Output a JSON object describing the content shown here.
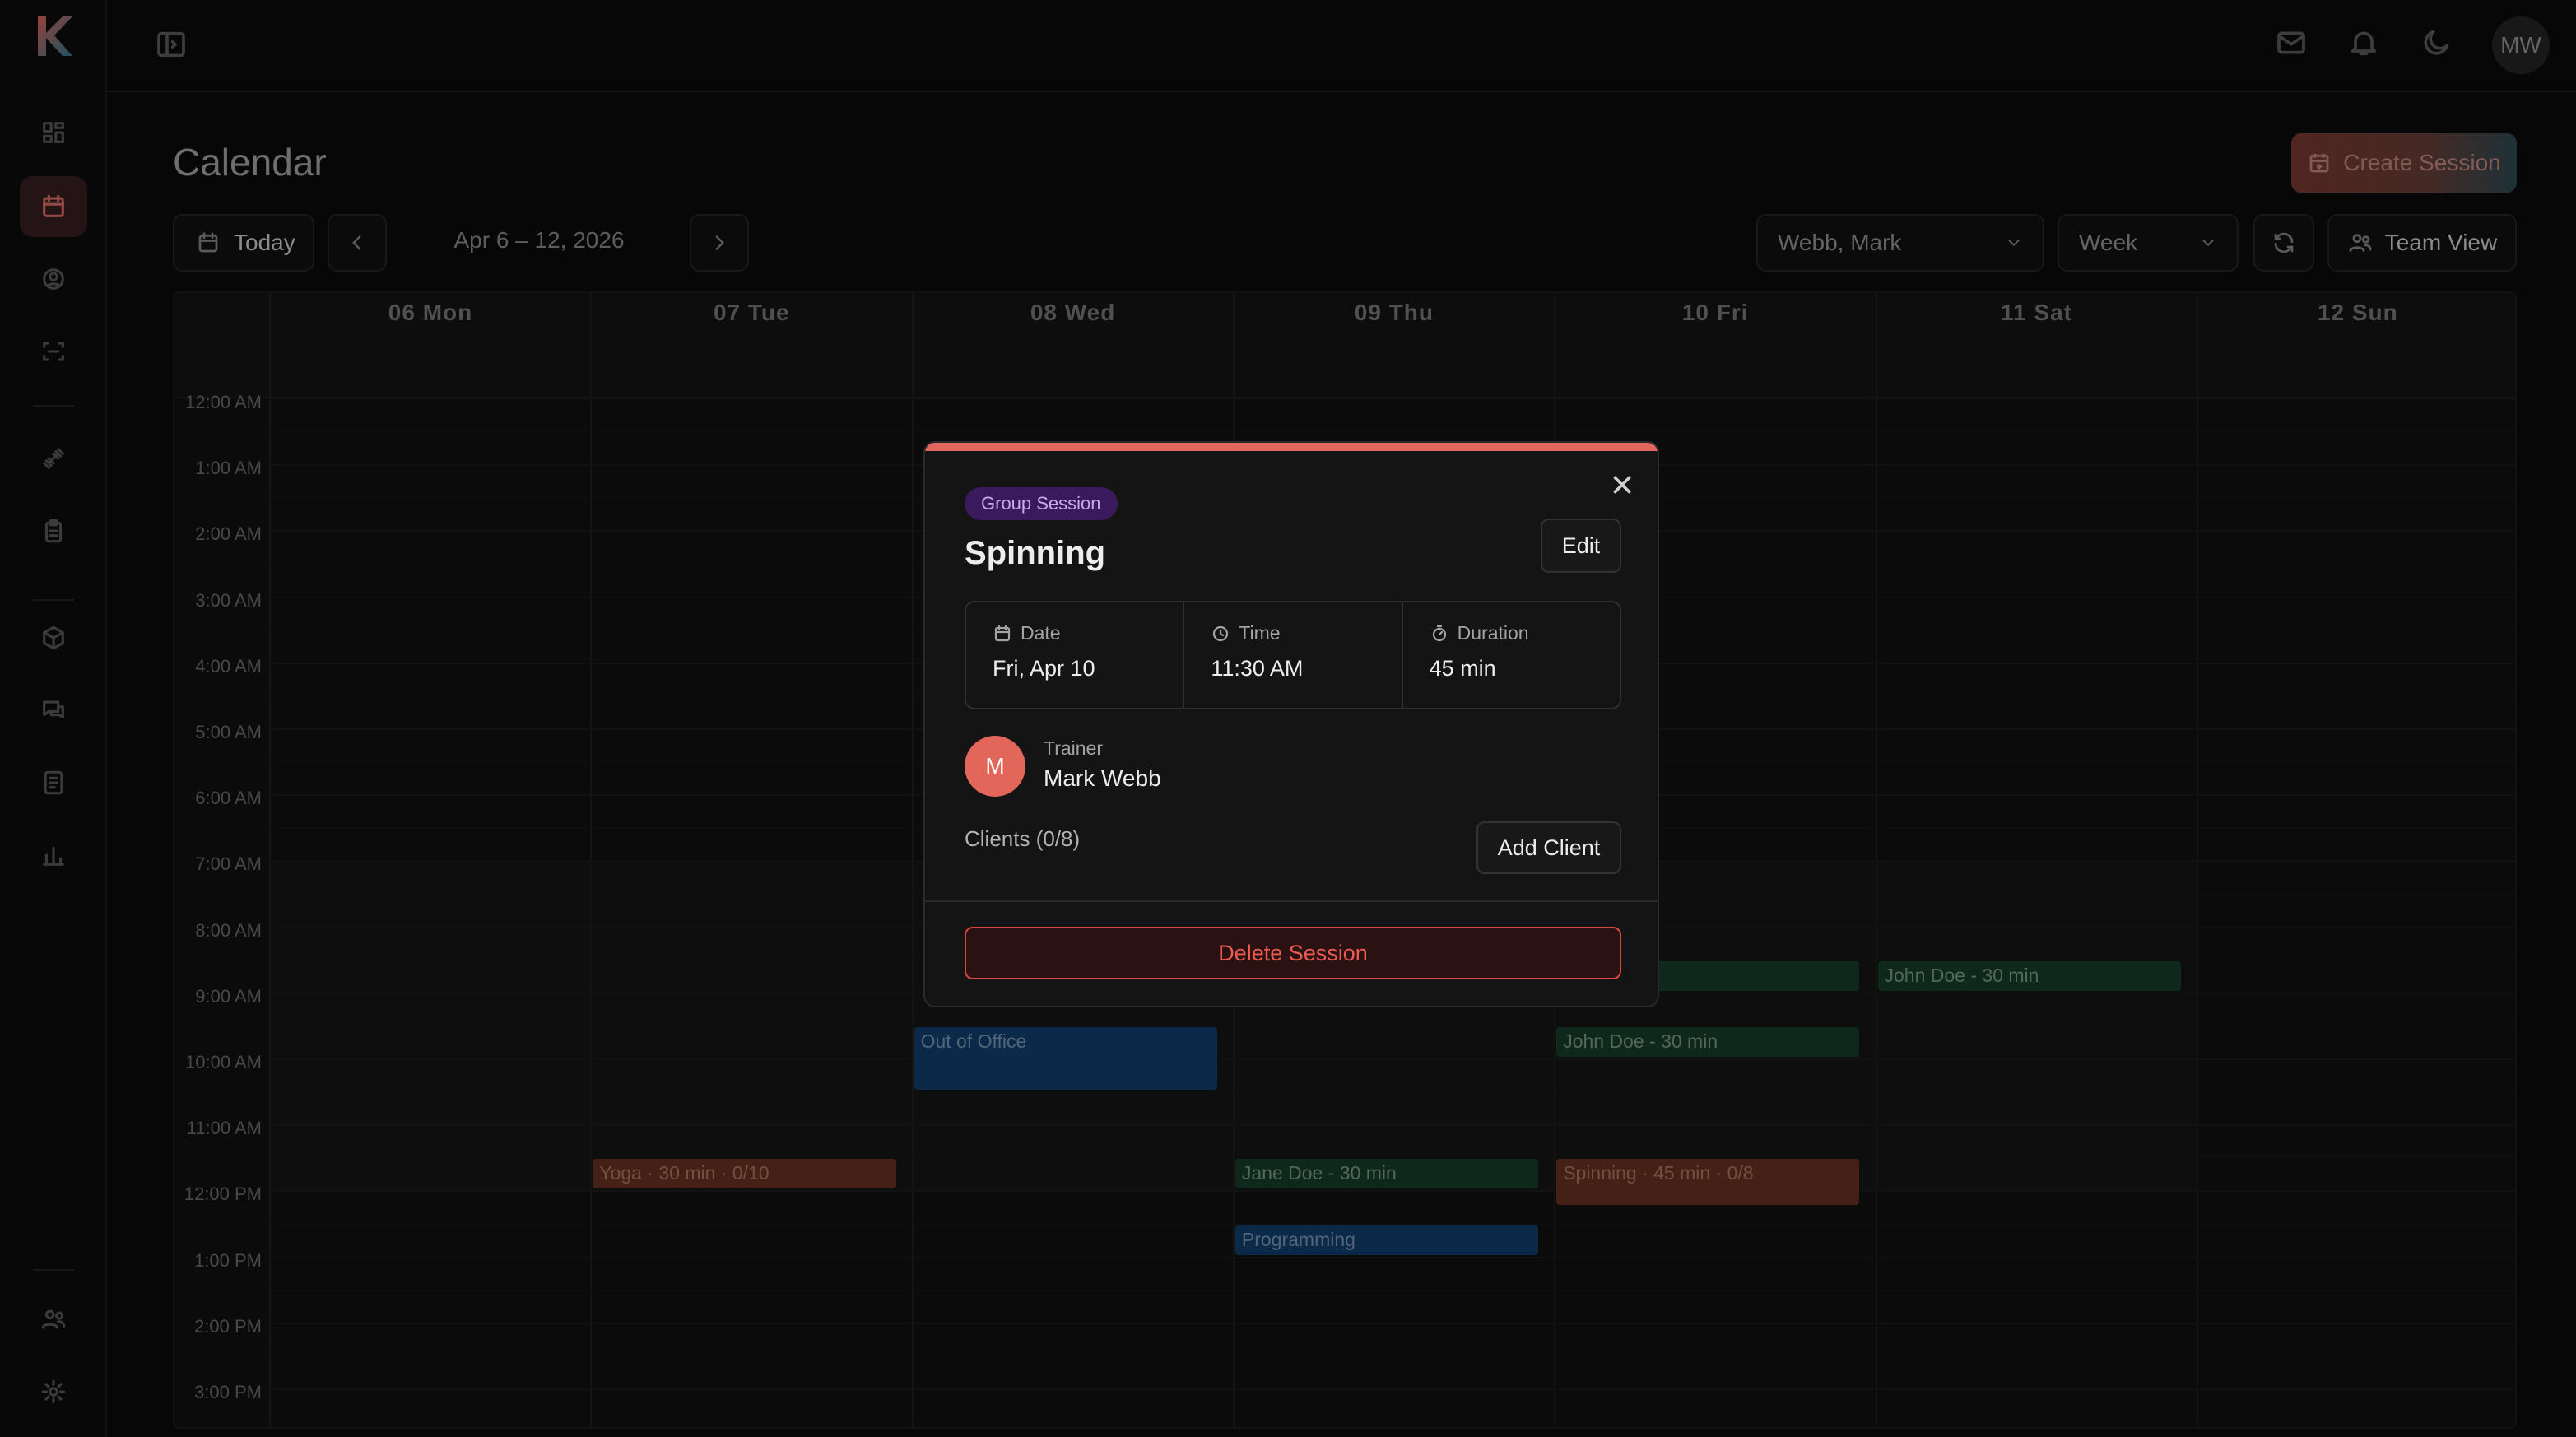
{
  "app": {
    "user_initials": "MW",
    "trainer_initial": "M"
  },
  "page": {
    "title": "Calendar",
    "create_label": "Create Session"
  },
  "toolbar": {
    "today_label": "Today",
    "date_range": "Apr 6 – 12, 2026",
    "trainer_select": "Webb, Mark",
    "view_select": "Week",
    "team_view_label": "Team View"
  },
  "calendar": {
    "days": [
      "06 Mon",
      "07 Tue",
      "08 Wed",
      "09 Thu",
      "10 Fri",
      "11 Sat",
      "12 Sun"
    ],
    "hours": [
      "12:00 AM",
      "1:00 AM",
      "2:00 AM",
      "3:00 AM",
      "4:00 AM",
      "5:00 AM",
      "6:00 AM",
      "7:00 AM",
      "8:00 AM",
      "9:00 AM",
      "10:00 AM",
      "11:00 AM",
      "12:00 PM",
      "1:00 PM",
      "2:00 PM",
      "3:00 PM"
    ],
    "events": [
      {
        "title": "30 min",
        "day": 4,
        "start": 8.5,
        "duration": 0.5,
        "color": "green"
      },
      {
        "title": "John Doe - 30 min",
        "day": 5,
        "start": 8.5,
        "duration": 0.5,
        "color": "green"
      },
      {
        "title": "Out of Office",
        "day": 2,
        "start": 9.5,
        "duration": 1.0,
        "color": "blue"
      },
      {
        "title": "John Doe - 30 min",
        "day": 4,
        "start": 9.5,
        "duration": 0.5,
        "color": "green"
      },
      {
        "title": "Yoga · 30 min · 0/10",
        "day": 1,
        "start": 11.5,
        "duration": 0.5,
        "color": "orange"
      },
      {
        "title": "Jane Doe - 30 min",
        "day": 3,
        "start": 11.5,
        "duration": 0.5,
        "color": "green"
      },
      {
        "title": "Spinning · 45 min · 0/8",
        "day": 4,
        "start": 11.5,
        "duration": 0.75,
        "color": "orange"
      },
      {
        "title": "Programming",
        "day": 3,
        "start": 12.5,
        "duration": 0.5,
        "color": "blue"
      }
    ]
  },
  "modal": {
    "badge": "Group Session",
    "title": "Spinning",
    "edit_label": "Edit",
    "date_label": "Date",
    "date_value": "Fri, Apr 10",
    "time_label": "Time",
    "time_value": "11:30 AM",
    "duration_label": "Duration",
    "duration_value": "45 min",
    "trainer_label": "Trainer",
    "trainer_name": "Mark Webb",
    "clients_label": "Clients (0/8)",
    "add_client_label": "Add Client",
    "delete_label": "Delete Session"
  },
  "colors": {
    "accent": "#e0675e",
    "green": "#163f2b",
    "blue": "#12406f",
    "orange": "#6a3222"
  }
}
